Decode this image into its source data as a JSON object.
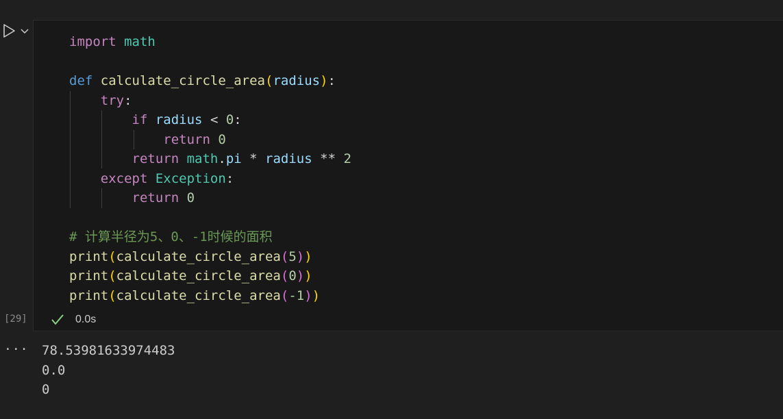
{
  "cell": {
    "execution_count": "[29]",
    "status_icon": "check-icon",
    "elapsed": "0.0s",
    "code": {
      "l1": {
        "kw": "import",
        "sp": " ",
        "mod": "math"
      },
      "l3": {
        "kw": "def",
        "sp": " ",
        "fn": "calculate_circle_area",
        "po": "(",
        "arg": "radius",
        "pc": ")",
        "colon": ":"
      },
      "l4": {
        "indent": "    ",
        "kw": "try",
        "colon": ":"
      },
      "l5": {
        "indent": "        ",
        "kw": "if",
        "sp": " ",
        "var": "radius",
        "op": " < ",
        "num": "0",
        "colon": ":"
      },
      "l6": {
        "indent": "            ",
        "kw": "return",
        "sp": " ",
        "num": "0"
      },
      "l7": {
        "indent": "        ",
        "kw": "return",
        "sp": " ",
        "mod": "math",
        "dot": ".",
        "attr": "pi",
        "op1": " * ",
        "var": "radius",
        "op2": " ** ",
        "num": "2"
      },
      "l8": {
        "indent": "    ",
        "kw": "except",
        "sp": " ",
        "cls": "Exception",
        "colon": ":"
      },
      "l9": {
        "indent": "        ",
        "kw": "return",
        "sp": " ",
        "num": "0"
      },
      "l11": {
        "comment": "# 计算半径为5、0、-1时候的面积"
      },
      "l12": {
        "fn1": "print",
        "po1": "(",
        "fn2": "calculate_circle_area",
        "po2": "(",
        "num": "5",
        "pc2": ")",
        "pc1": ")"
      },
      "l13": {
        "fn1": "print",
        "po1": "(",
        "fn2": "calculate_circle_area",
        "po2": "(",
        "num": "0",
        "pc2": ")",
        "pc1": ")"
      },
      "l14": {
        "fn1": "print",
        "po1": "(",
        "fn2": "calculate_circle_area",
        "po2": "(",
        "num": "-1",
        "pc2": ")",
        "pc1": ")"
      }
    }
  },
  "output": {
    "more_label": "···",
    "lines": [
      "78.53981633974483",
      "0.0",
      "0"
    ]
  },
  "colors": {
    "background": "#1f1f1f",
    "cell_background": "#181818",
    "success": "#89d185"
  }
}
